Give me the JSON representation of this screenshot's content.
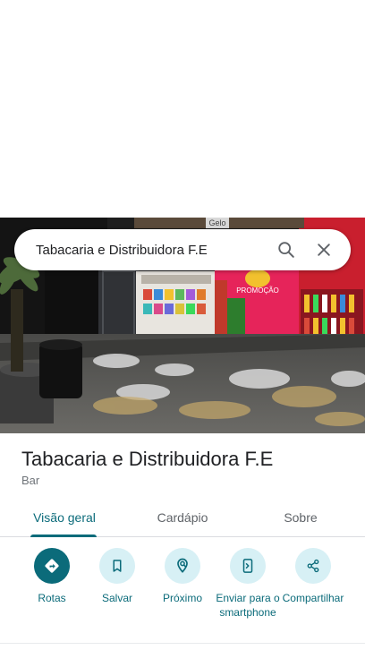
{
  "search": {
    "query": "Tabacaria e Distribuidora F.E"
  },
  "place": {
    "name": "Tabacaria e Distribuidora F.E",
    "category": "Bar"
  },
  "tabs": [
    {
      "label": "Visão geral",
      "active": true
    },
    {
      "label": "Cardápio",
      "active": false
    },
    {
      "label": "Sobre",
      "active": false
    }
  ],
  "actions": [
    {
      "label": "Rotas",
      "icon": "directions-icon"
    },
    {
      "label": "Salvar",
      "icon": "bookmark-icon"
    },
    {
      "label": "Próximo",
      "icon": "nearby-icon"
    },
    {
      "label": "Enviar para o smartphone",
      "icon": "send-to-phone-icon"
    },
    {
      "label": "Compartilhar",
      "icon": "share-icon"
    }
  ],
  "photo": {
    "sign_text": "PROMOÇÃO",
    "top_text": "Gelo"
  },
  "colors": {
    "accent": "#0b6b7a",
    "action_bg": "#d7f0f5",
    "text_primary": "#202124",
    "text_secondary": "#70757a"
  }
}
